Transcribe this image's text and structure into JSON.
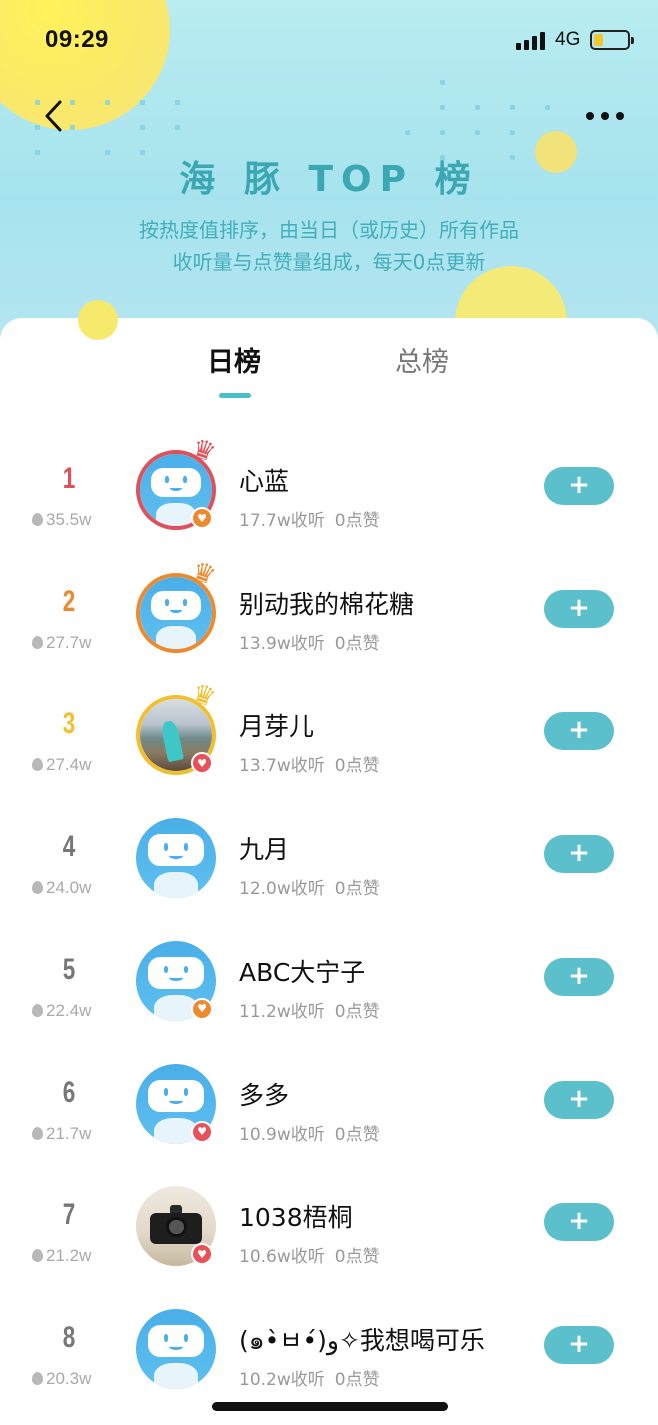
{
  "status_bar": {
    "time": "09:29",
    "network": "4G"
  },
  "header": {
    "title": "海 豚 TOP 榜",
    "subtitle_line1": "按热度值排序，由当日（或历史）所有作品",
    "subtitle_line2": "收听量与点赞量组成，每天0点更新"
  },
  "tabs": [
    {
      "label": "日榜",
      "active": true
    },
    {
      "label": "总榜",
      "active": false
    }
  ],
  "follow_label": "+",
  "colors": {
    "accent": "#5bc0cb",
    "rank1": "#e0505a",
    "rank2": "#ee8a2e",
    "rank3": "#f0c030",
    "rank_other": "#777777",
    "badge_orange": "#ee8a2e",
    "badge_red": "#e8505a"
  },
  "ranking": [
    {
      "rank": "1",
      "heat": "35.5w",
      "name": "心蓝",
      "listens": "17.7w收听",
      "likes": "0点赞",
      "avatar": "robot",
      "badge": "heart-orange",
      "crown": true
    },
    {
      "rank": "2",
      "heat": "27.7w",
      "name": "别动我的棉花糖",
      "listens": "13.9w收听",
      "likes": "0点赞",
      "avatar": "robot",
      "badge": null,
      "crown": true
    },
    {
      "rank": "3",
      "heat": "27.4w",
      "name": "月芽儿",
      "listens": "13.7w收听",
      "likes": "0点赞",
      "avatar": "photo-sea",
      "badge": "heart-red",
      "crown": true
    },
    {
      "rank": "4",
      "heat": "24.0w",
      "name": "九月",
      "listens": "12.0w收听",
      "likes": "0点赞",
      "avatar": "robot",
      "badge": null,
      "crown": false
    },
    {
      "rank": "5",
      "heat": "22.4w",
      "name": "ABC大宁子",
      "listens": "11.2w收听",
      "likes": "0点赞",
      "avatar": "robot",
      "badge": "heart-orange",
      "crown": false
    },
    {
      "rank": "6",
      "heat": "21.7w",
      "name": "多多",
      "listens": "10.9w收听",
      "likes": "0点赞",
      "avatar": "robot",
      "badge": "heart-red",
      "crown": false
    },
    {
      "rank": "7",
      "heat": "21.2w",
      "name": "1038梧桐",
      "listens": "10.6w收听",
      "likes": "0点赞",
      "avatar": "photo-camera",
      "badge": "heart-red",
      "crown": false
    },
    {
      "rank": "8",
      "heat": "20.3w",
      "name": "(๑•̀ㅂ•́)و✧我想喝可乐",
      "listens": "10.2w收听",
      "likes": "0点赞",
      "avatar": "robot",
      "badge": null,
      "crown": false
    }
  ]
}
